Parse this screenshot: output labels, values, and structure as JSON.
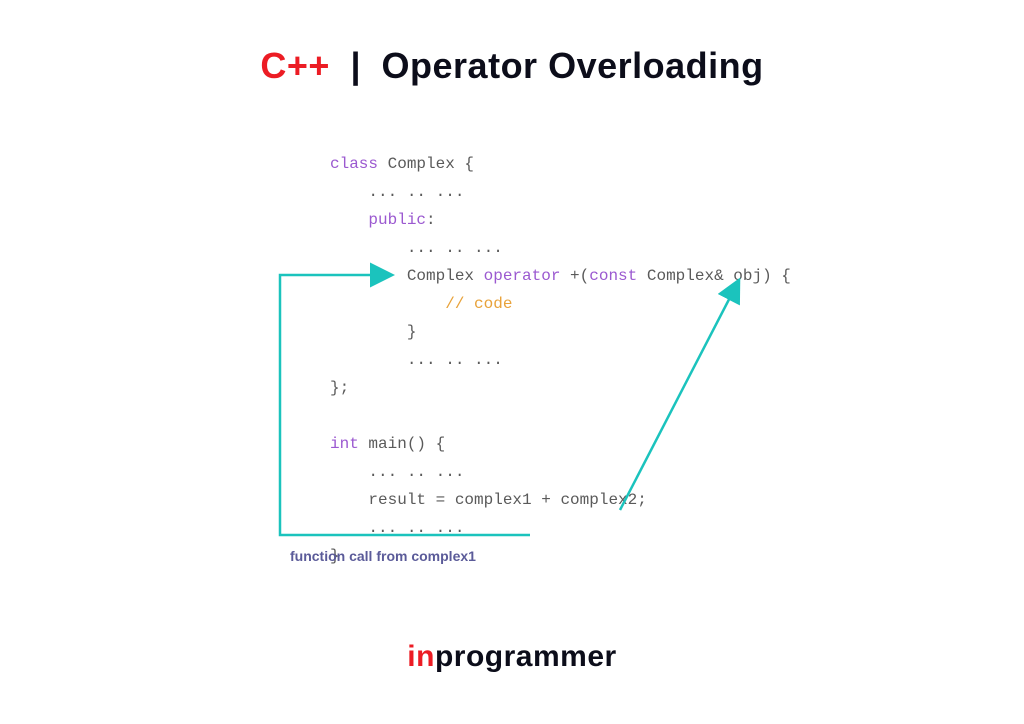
{
  "header": {
    "cpp": "C++",
    "pipe": "|",
    "topic": "Operator Overloading"
  },
  "code": {
    "l1a": "class",
    "l1b": " Complex {",
    "l2": "    ... .. ...",
    "l3a": "    ",
    "l3b": "public",
    "l3c": ":",
    "l4": "        ... .. ...",
    "l5a": "        Complex ",
    "l5b": "operator",
    "l5c": " +(",
    "l5d": "const",
    "l5e": " Complex& obj) {",
    "l6a": "            ",
    "l6b": "// code",
    "l7": "        }",
    "l8": "        ... .. ...",
    "l9": "};",
    "l10": "",
    "l11a": "int",
    "l11b": " main() {",
    "l12": "    ... .. ...",
    "l13": "    result = complex1 + complex2;",
    "l14": "    ... .. ...",
    "l15": "}"
  },
  "caption": "function call from complex1",
  "footer": {
    "in": "in",
    "rest": "programmer"
  },
  "colors": {
    "accent_teal": "#1bc3bd",
    "accent_red": "#ec1c24",
    "text_dark": "#0c0d1a",
    "code_gray": "#5a5a5a",
    "purple": "#9b59d0",
    "orange": "#e8a23a",
    "caption_purple": "#5b5b99"
  }
}
